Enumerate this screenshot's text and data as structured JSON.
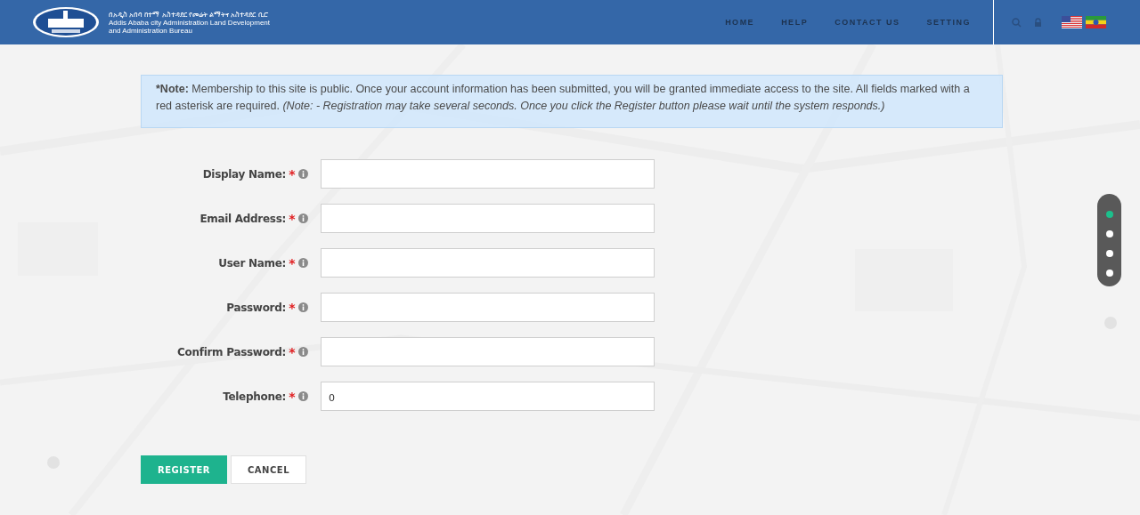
{
  "header": {
    "org_name_lines": [
      "በአዲስ አበባ ከተማ አስተዳደር የመሬት ልማትና አስተዳደር ቢሮ",
      "Addis Ababa city Administration Land Development",
      "and Administration Bureau"
    ],
    "nav": [
      "HOME",
      "HELP",
      "CONTACT US",
      "SETTING"
    ],
    "languages": [
      {
        "kind": "us"
      },
      {
        "kind": "et"
      }
    ]
  },
  "note": {
    "text": "***Note:** Membership to this site is public. Once your account information has been submitted, you will be granted immediate access to the site. All fields marked with a red asterisk are required. *(Note: - Registration may take several seconds. Once you click the Register button please wait until the system responds.)*"
  },
  "fields": [
    {
      "label": "Display Name:",
      "required_mark": "*"
    },
    {
      "label": "Email Address:",
      "required_mark": "*"
    },
    {
      "label": "User Name:",
      "required_mark": "*"
    },
    {
      "label": "Password:",
      "required_mark": "*"
    },
    {
      "label": "Confirm Password:",
      "required_mark": "*"
    },
    {
      "label": "Telephone:",
      "required_mark": "*",
      "value": "0"
    }
  ],
  "buttons": [
    {
      "label": "REGISTER",
      "kind": "primary"
    },
    {
      "label": "CANCEL",
      "kind": "secondary"
    }
  ],
  "slide_dots": [
    {
      "selected": true
    },
    {
      "selected": false
    },
    {
      "selected": false
    },
    {
      "selected": false
    }
  ]
}
